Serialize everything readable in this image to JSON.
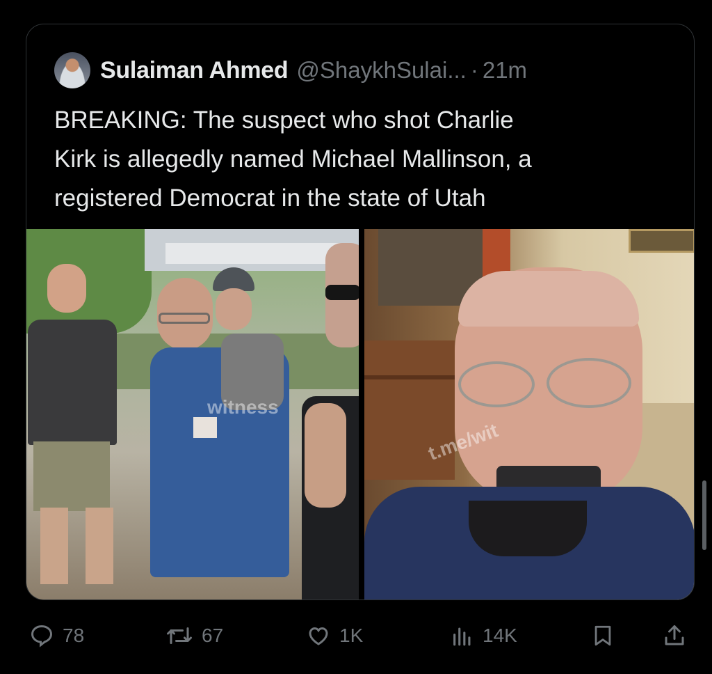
{
  "quoted_post": {
    "author_name": "Sulaiman Ahmed",
    "author_handle": "@ShaykhSulai...",
    "separator": "·",
    "timestamp": "21m",
    "text": "BREAKING: The suspect who shot Charlie\nKirk is allegedly named Michael Mallinson, a\nregistered Democrat in the state of Utah",
    "media": [
      {
        "watermark": "witness"
      },
      {
        "watermark": "t.me/wit"
      }
    ]
  },
  "actions": {
    "replies": "78",
    "reposts": "67",
    "likes": "1K",
    "views": "14K"
  },
  "colors": {
    "background": "#000000",
    "text_primary": "#e7e9ea",
    "text_secondary": "#71767b",
    "border": "#2f3336"
  }
}
